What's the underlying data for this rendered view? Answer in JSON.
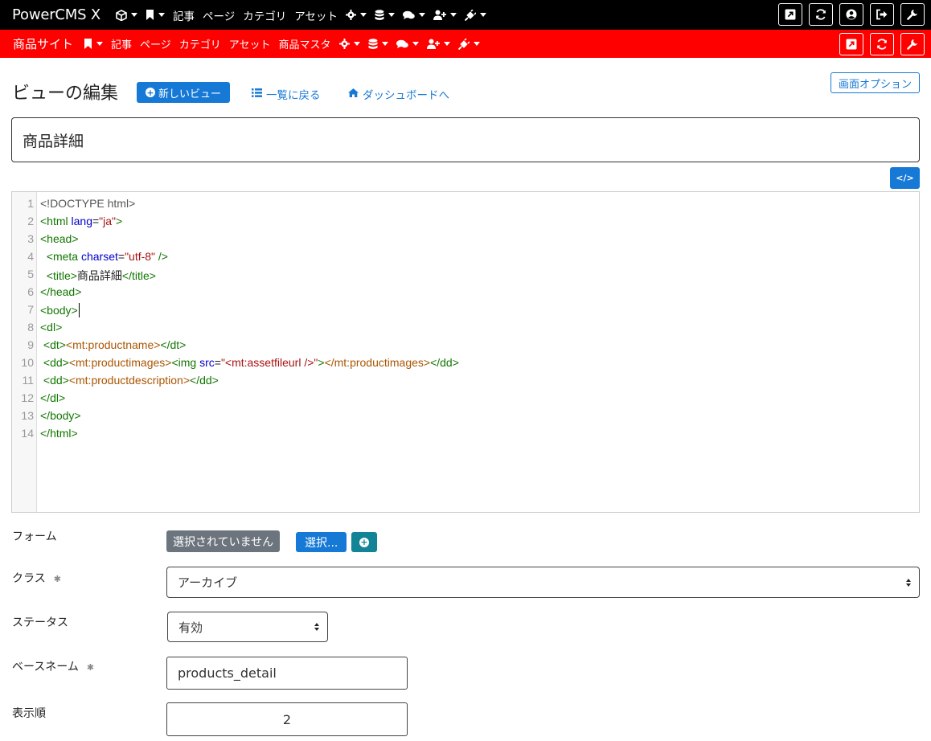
{
  "topnav": {
    "brand": "PowerCMS X",
    "items": [
      {
        "icon": "cube-icon",
        "label": "",
        "caret": true
      },
      {
        "icon": "bookmark-icon",
        "label": "",
        "caret": true
      },
      {
        "icon": "",
        "label": "記事",
        "caret": false
      },
      {
        "icon": "",
        "label": "ページ",
        "caret": false
      },
      {
        "icon": "",
        "label": "カテゴリ",
        "caret": false
      },
      {
        "icon": "",
        "label": "アセット",
        "caret": false
      },
      {
        "icon": "gear-icon",
        "label": "",
        "caret": true
      },
      {
        "icon": "database-icon",
        "label": "",
        "caret": true
      },
      {
        "icon": "comments-icon",
        "label": "",
        "caret": true
      },
      {
        "icon": "user-plus-icon",
        "label": "",
        "caret": true
      },
      {
        "icon": "plug-icon",
        "label": "",
        "caret": true
      }
    ],
    "right_buttons": [
      "external-link-icon",
      "refresh-icon",
      "user-circle-icon",
      "sign-out-icon",
      "wrench-icon"
    ]
  },
  "sitenav": {
    "site_name": "商品サイト",
    "items": [
      {
        "icon": "bookmark-icon",
        "label": "",
        "caret": true
      },
      {
        "icon": "",
        "label": "記事",
        "caret": false
      },
      {
        "icon": "",
        "label": "ページ",
        "caret": false
      },
      {
        "icon": "",
        "label": "カテゴリ",
        "caret": false
      },
      {
        "icon": "",
        "label": "アセット",
        "caret": false
      },
      {
        "icon": "",
        "label": "商品マスタ",
        "caret": false
      },
      {
        "icon": "gear-icon",
        "label": "",
        "caret": true
      },
      {
        "icon": "database-icon",
        "label": "",
        "caret": true
      },
      {
        "icon": "comments-icon",
        "label": "",
        "caret": true
      },
      {
        "icon": "user-plus-icon",
        "label": "",
        "caret": true
      },
      {
        "icon": "plug-icon",
        "label": "",
        "caret": true
      }
    ],
    "right_buttons": [
      "external-link-icon",
      "refresh-icon",
      "wrench-icon"
    ]
  },
  "header": {
    "title": "ビューの編集",
    "new_button": "新しいビュー",
    "back_link": "一覧に戻る",
    "dashboard_link": "ダッシュボードへ",
    "screen_options": "画面オプション"
  },
  "view_name": "商品詳細",
  "code_toggle_label": "</>",
  "code_lines": [
    "1",
    "2",
    "3",
    "4",
    "5",
    "6",
    "7",
    "8",
    "9",
    "10",
    "11",
    "12",
    "13",
    "14"
  ],
  "code": {
    "l1": "<!DOCTYPE html>",
    "l2_open": "<html ",
    "l2_attr": "lang",
    "l2_eq": "=",
    "l2_val": "\"ja\"",
    "l2_close": ">",
    "l3": "<head>",
    "l4_open": "  <meta ",
    "l4_attr": "charset",
    "l4_eq": "=",
    "l4_val": "\"utf-8\"",
    "l4_close": " />",
    "l5_open": "  <title>",
    "l5_text": "商品詳細",
    "l5_close": "</title>",
    "l6": "</head>",
    "l7": "<body>",
    "l8": "<dl>",
    "l9_a": " <dt>",
    "l9_b": "<mt:productname>",
    "l9_c": "</dt>",
    "l10_a": " <dd>",
    "l10_b": "<mt:productimages>",
    "l10_c": "<img ",
    "l10_d": "src",
    "l10_e": "=",
    "l10_f": "\"<mt:assetfileurl />\"",
    "l10_g": ">",
    "l10_h": "</mt:productimages>",
    "l10_i": "</dd>",
    "l11_a": " <dd>",
    "l11_b": "<mt:productdescription>",
    "l11_c": "</dd>",
    "l12": "</dl>",
    "l13": "</body>",
    "l14": "</html>"
  },
  "form": {
    "form_label": "フォーム",
    "form_none": "選択されていません",
    "form_select": "選択...",
    "class_label": "クラス",
    "class_value": "アーカイブ",
    "status_label": "ステータス",
    "status_value": "有効",
    "basename_label": "ベースネーム",
    "basename_value": "products_detail",
    "order_label": "表示順",
    "order_value": "2"
  },
  "colors": {
    "topbar": "#000000",
    "sitebar": "#ff0000",
    "primary": "#1779d6",
    "teal": "#138496",
    "gray_badge": "#6c757d"
  }
}
